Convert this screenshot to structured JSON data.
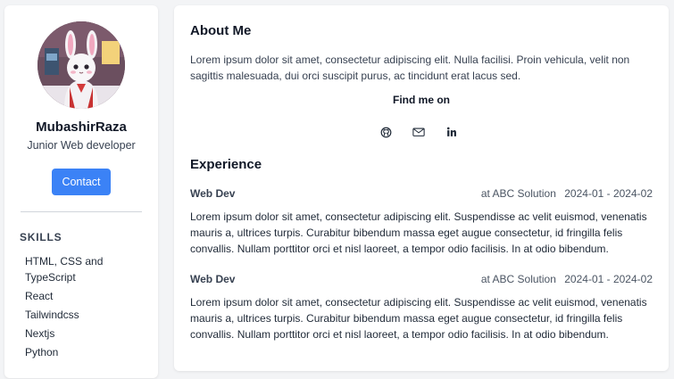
{
  "profile": {
    "name": "MubashirRaza",
    "role": "Junior Web developer",
    "contact_label": "Contact"
  },
  "skills": {
    "heading": "SKILLS",
    "items": [
      "HTML, CSS and TypeScript",
      "React",
      "Tailwindcss",
      "Nextjs",
      "Python"
    ]
  },
  "about": {
    "title": "About Me",
    "text": "Lorem ipsum dolor sit amet, consectetur adipiscing elit. Nulla facilisi. Proin vehicula, velit non sagittis malesuada, dui orci suscipit purus, ac tincidunt erat lacus sed.",
    "find_me": "Find me on",
    "socials": [
      "github-icon",
      "mail-icon",
      "linkedin-icon"
    ]
  },
  "experience": {
    "title": "Experience",
    "items": [
      {
        "role": "Web Dev",
        "company": "at ABC Solution",
        "period": "2024-01 - 2024-02",
        "description": "Lorem ipsum dolor sit amet, consectetur adipiscing elit. Suspendisse ac velit euismod, venenatis mauris a, ultrices turpis. Curabitur bibendum massa eget augue consectetur, id fringilla felis convallis. Nullam porttitor orci et nisl laoreet, a tempor odio facilisis. In at odio bibendum."
      },
      {
        "role": "Web Dev",
        "company": "at ABC Solution",
        "period": "2024-01 - 2024-02",
        "description": "Lorem ipsum dolor sit amet, consectetur adipiscing elit. Suspendisse ac velit euismod, venenatis mauris a, ultrices turpis. Curabitur bibendum massa eget augue consectetur, id fringilla felis convallis. Nullam porttitor orci et nisl laoreet, a tempor odio facilisis. In at odio bibendum."
      }
    ]
  },
  "colors": {
    "accent": "#3b82f6",
    "page_background": "#f3f4f6",
    "card_background": "#ffffff"
  }
}
